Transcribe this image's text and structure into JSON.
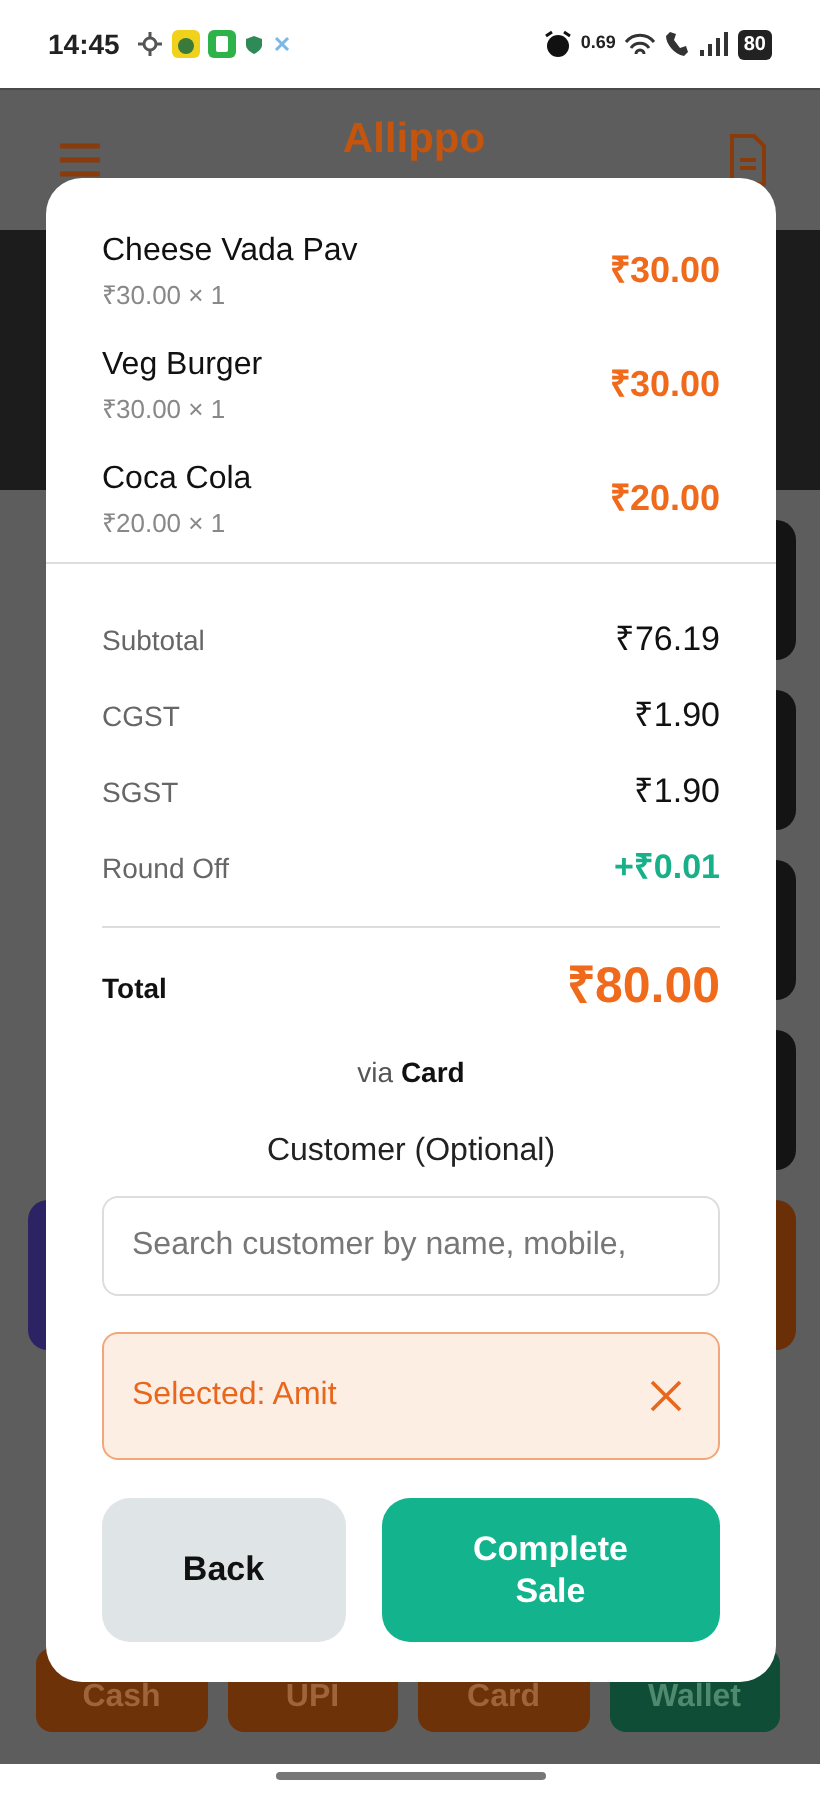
{
  "status_bar": {
    "time": "14:45",
    "net_speed": "0.69",
    "battery": "80"
  },
  "app": {
    "title": "Allippo",
    "payment_methods": [
      {
        "label": "Cash",
        "kind": "orange"
      },
      {
        "label": "UPI",
        "kind": "orange"
      },
      {
        "label": "Card",
        "kind": "orange"
      },
      {
        "label": "Wallet",
        "kind": "green"
      }
    ]
  },
  "modal": {
    "items": [
      {
        "name": "Cheese Vada Pav",
        "detail": "₹30.00 × 1",
        "amount": "₹30.00"
      },
      {
        "name": "Veg Burger",
        "detail": "₹30.00 × 1",
        "amount": "₹30.00"
      },
      {
        "name": "Coca Cola",
        "detail": "₹20.00 × 1",
        "amount": "₹20.00"
      }
    ],
    "summary": [
      {
        "label": "Subtotal",
        "value": "₹76.19",
        "kind": "normal"
      },
      {
        "label": "CGST",
        "value": "₹1.90",
        "kind": "normal"
      },
      {
        "label": "SGST",
        "value": "₹1.90",
        "kind": "normal"
      },
      {
        "label": "Round Off",
        "value": "+₹0.01",
        "kind": "adjustment"
      }
    ],
    "total": {
      "label": "Total",
      "value": "₹80.00"
    },
    "payment_via": "via **Card**",
    "customer_label": "Customer (Optional)",
    "search": {
      "placeholder": "Search customer by name, mobile,"
    },
    "selected_customer": "Selected: Amit",
    "buttons": [
      {
        "label": "Back",
        "kind": "secondary"
      },
      {
        "label": "Complete Sale",
        "kind": "primary"
      }
    ]
  }
}
